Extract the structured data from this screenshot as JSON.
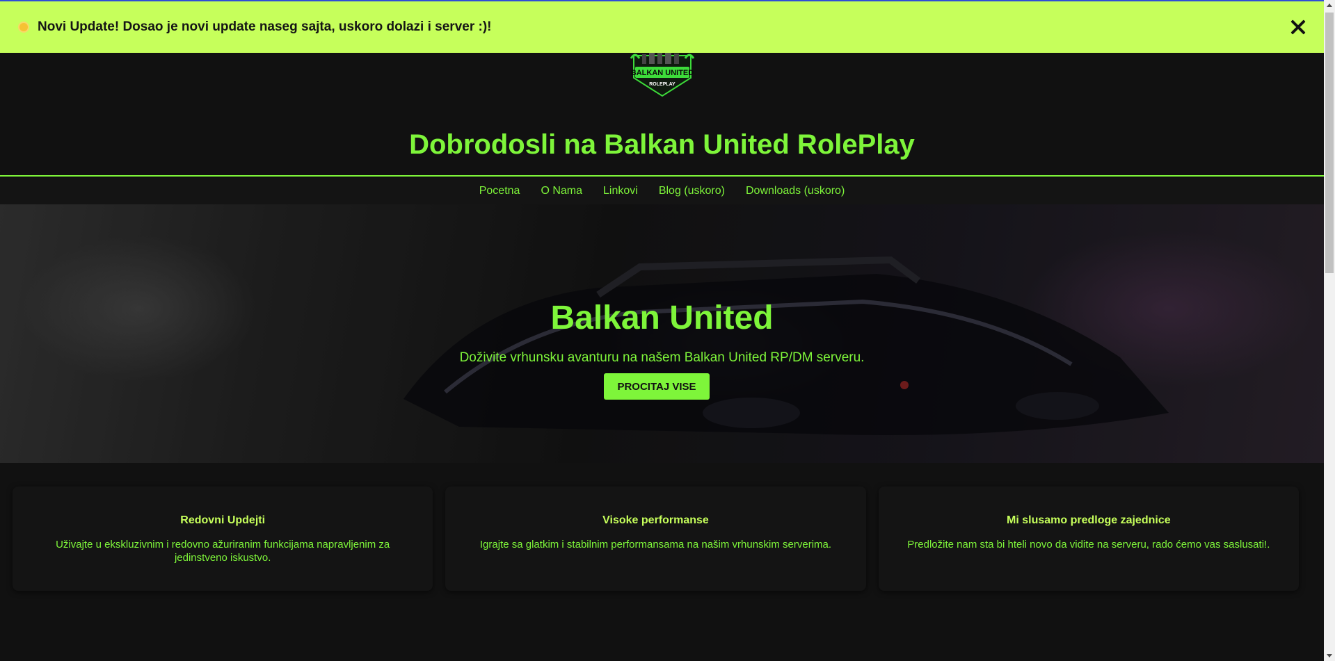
{
  "announcement": {
    "message": "Novi Update! Dosao je novi update naseg sajta, uskoro dolazi i server :)!",
    "icon": "sun-icon",
    "background": "#c6ff5b"
  },
  "header": {
    "logo_text": "BALKAN UNITED",
    "logo_subtext": "ROLEPLAY",
    "title": "Dobrodosli na Balkan United RolePlay"
  },
  "nav": {
    "items": [
      {
        "label": "Pocetna"
      },
      {
        "label": "O Nama"
      },
      {
        "label": "Linkovi"
      },
      {
        "label": "Blog (uskoro)"
      },
      {
        "label": "Downloads (uskoro)"
      }
    ]
  },
  "hero": {
    "title": "Balkan United",
    "subtitle": "Doživite vrhunsku avanturu na našem Balkan United RP/DM serveru.",
    "button_label": "PROCITAJ VISE"
  },
  "features": [
    {
      "title": "Redovni Updejti",
      "text": "Uživajte u ekskluzivnim i redovno ažuriranim funkcijama napravljenim za jedinstveno iskustvo."
    },
    {
      "title": "Visoke performanse",
      "text": "Igrajte sa glatkim i stabilnim performansama na našim vrhunskim serverima."
    },
    {
      "title": "Mi slusamo predloge zajednice",
      "text": "Predložite nam sta bi hteli novo da vidite na serveru, rado ćemo vas saslusati!."
    }
  ],
  "colors": {
    "accent": "#7ef53a",
    "background": "#111111",
    "banner": "#c6ff5b"
  }
}
